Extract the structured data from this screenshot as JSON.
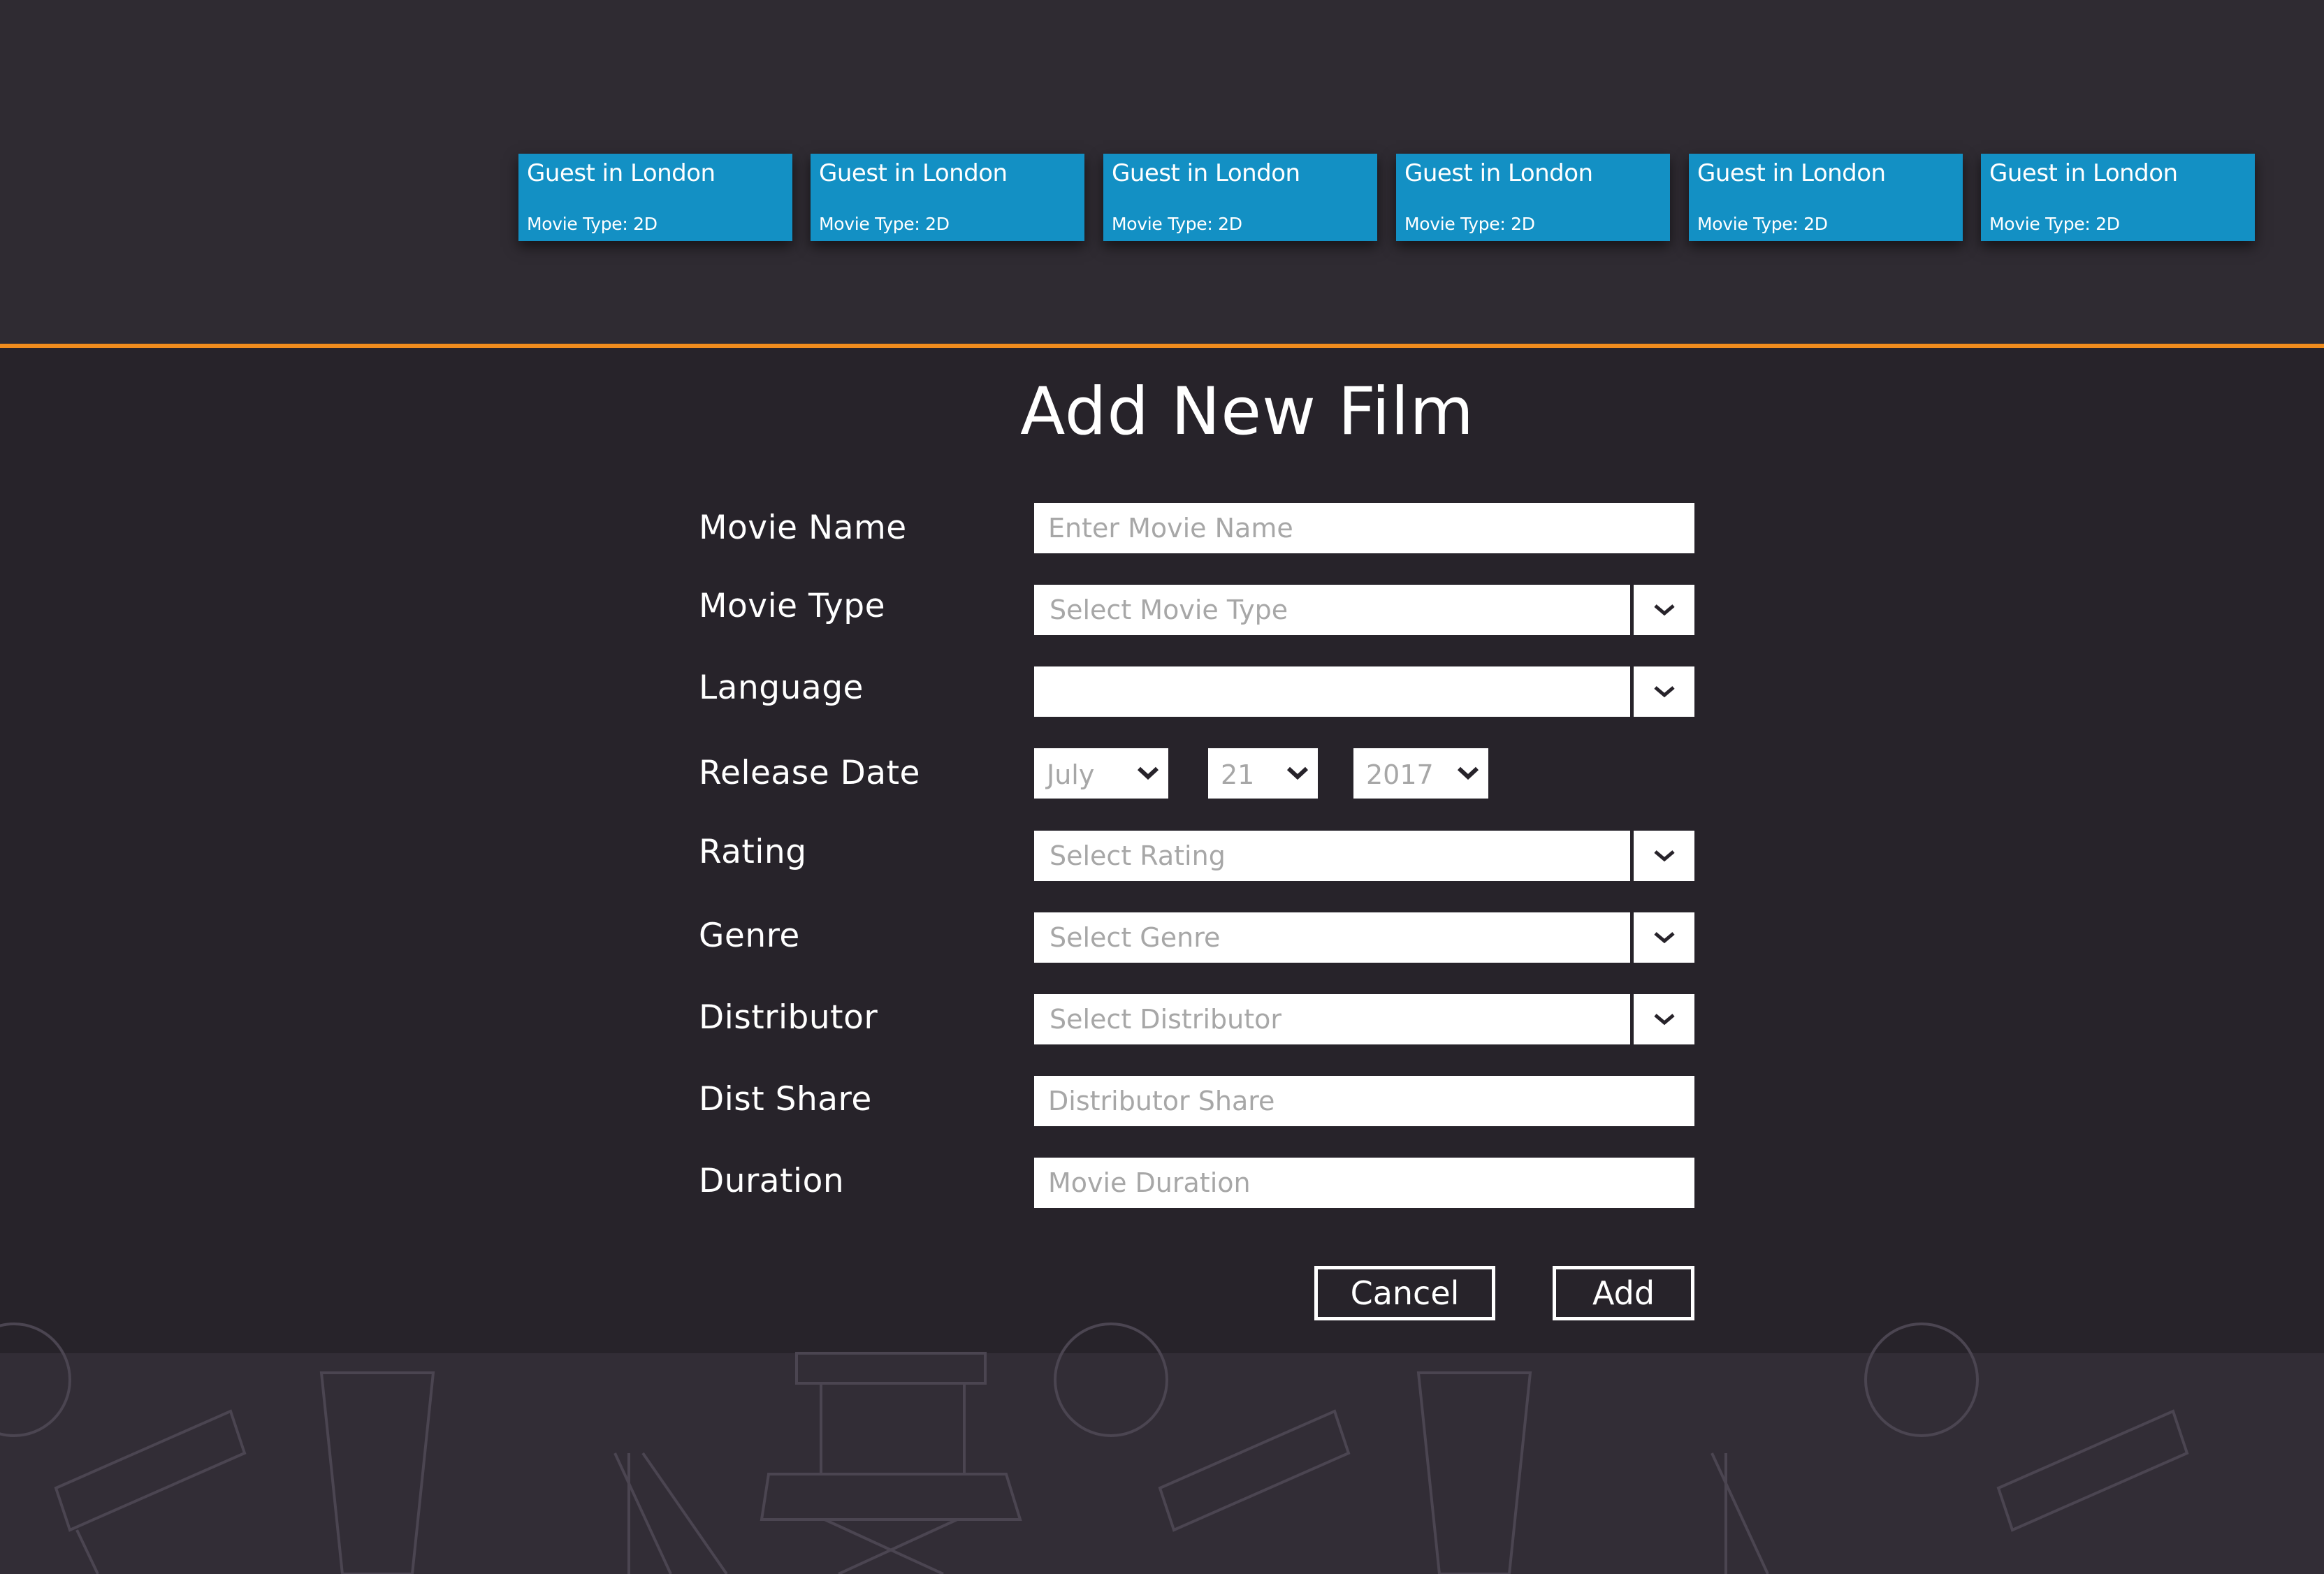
{
  "movie_cards": [
    {
      "title": "Guest in London",
      "type_label": "Movie Type: 2D"
    },
    {
      "title": "Guest in London",
      "type_label": "Movie Type: 2D"
    },
    {
      "title": "Guest in London",
      "type_label": "Movie Type: 2D"
    },
    {
      "title": "Guest in London",
      "type_label": "Movie Type: 2D"
    },
    {
      "title": "Guest in London",
      "type_label": "Movie Type: 2D"
    },
    {
      "title": "Guest in London",
      "type_label": "Movie Type: 2D"
    }
  ],
  "colors": {
    "accent_orange": "#f08c1e",
    "card_blue": "#1390c4",
    "background": "#27232a"
  },
  "form": {
    "title": "Add New Film",
    "movie_name": {
      "label": "Movie Name",
      "placeholder": "Enter Movie Name",
      "value": ""
    },
    "movie_type": {
      "label": "Movie Type",
      "placeholder": "Select Movie Type",
      "value": ""
    },
    "language": {
      "label": "Language",
      "placeholder": "",
      "value": ""
    },
    "release_date": {
      "label": "Release Date",
      "month": "July",
      "day": "21",
      "year": "2017"
    },
    "rating": {
      "label": "Rating",
      "placeholder": "Select Rating",
      "value": ""
    },
    "genre": {
      "label": "Genre",
      "placeholder": "Select Genre",
      "value": ""
    },
    "distributor": {
      "label": "Distributor",
      "placeholder": "Select Distributor",
      "value": ""
    },
    "dist_share": {
      "label": "Dist Share",
      "placeholder": "Distributor Share",
      "value": ""
    },
    "duration": {
      "label": "Duration",
      "placeholder": "Movie Duration",
      "value": ""
    },
    "cancel_label": "Cancel",
    "add_label": "Add"
  },
  "icons": {
    "dropdown": "chevron-down-icon"
  }
}
